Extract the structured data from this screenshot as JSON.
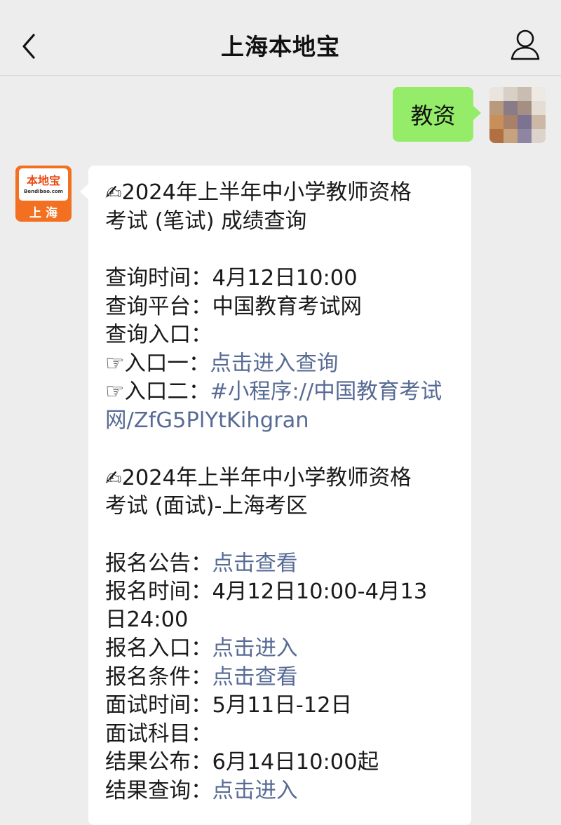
{
  "nav": {
    "title": "上海本地宝",
    "back_icon": "chevron-left-icon",
    "profile_icon": "person-outline-icon"
  },
  "outgoing": {
    "text": "教资"
  },
  "sender": {
    "logo_main": "本地宝",
    "logo_sub": "Bendibao.com",
    "logo_city": "上海"
  },
  "message": {
    "emoji": "✍",
    "pointer": "☞",
    "s1_title_a": "2024年上半年中小学教师资格",
    "s1_title_b": "考试 (笔试) 成绩查询",
    "time_label": "查询时间：",
    "time_value": "4月12日10:00",
    "platform_label": "查询平台：",
    "platform_value": "中国教育考试网",
    "entry_label": "查询入口：",
    "entry1_label": "入口一：",
    "entry1_link": "点击进入查询",
    "entry2_label": "入口二：",
    "entry2_link_a": "#小程序://中国教育考试",
    "entry2_link_b": "网/ZfG5PlYtKihgran",
    "s2_title_a": "2024年上半年中小学教师资格",
    "s2_title_b": "考试 (面试)-上海考区",
    "notice_label": "报名公告：",
    "notice_link": "点击查看",
    "reg_time_label": "报名时间：",
    "reg_time_value_a": "4月12日10:00-4月13",
    "reg_time_value_b": "日24:00",
    "reg_entry_label": "报名入口：",
    "reg_entry_link": "点击进入",
    "reg_cond_label": "报名条件：",
    "reg_cond_link": "点击查看",
    "interview_time_label": "面试时间：",
    "interview_time_value": "5月11日-12日",
    "interview_subject_label": "面试科目：",
    "result_pub_label": "结果公布：",
    "result_pub_value": "6月14日10:00起",
    "result_query_label": "结果查询：",
    "result_query_link": "点击进入"
  }
}
